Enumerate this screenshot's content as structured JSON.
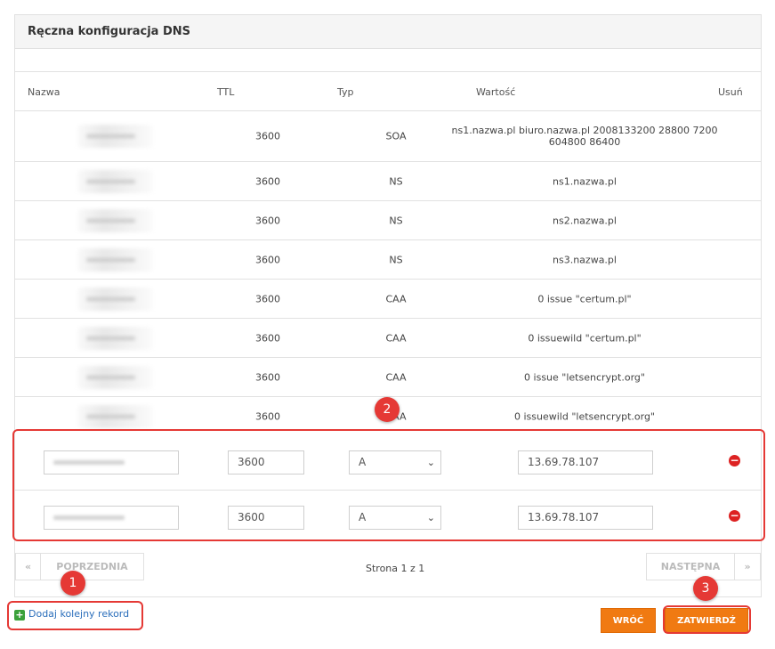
{
  "panel": {
    "title": "Ręczna konfiguracja DNS"
  },
  "table": {
    "headers": {
      "name": "Nazwa",
      "ttl": "TTL",
      "type": "Typ",
      "value": "Wartość",
      "delete": "Usuń"
    },
    "rows": [
      {
        "ttl": "3600",
        "type": "SOA",
        "value": "ns1.nazwa.pl biuro.nazwa.pl 2008133200 28800 7200 604800 86400"
      },
      {
        "ttl": "3600",
        "type": "NS",
        "value": "ns1.nazwa.pl"
      },
      {
        "ttl": "3600",
        "type": "NS",
        "value": "ns2.nazwa.pl"
      },
      {
        "ttl": "3600",
        "type": "NS",
        "value": "ns3.nazwa.pl"
      },
      {
        "ttl": "3600",
        "type": "CAA",
        "value": "0 issue \"certum.pl\""
      },
      {
        "ttl": "3600",
        "type": "CAA",
        "value": "0 issuewild \"certum.pl\""
      },
      {
        "ttl": "3600",
        "type": "CAA",
        "value": "0 issue \"letsencrypt.org\""
      },
      {
        "ttl": "3600",
        "type": "CAA",
        "value": "0 issuewild \"letsencrypt.org\""
      }
    ],
    "edit_rows": [
      {
        "ttl": "3600",
        "type": "A",
        "value": "13.69.78.107"
      },
      {
        "ttl": "3600",
        "type": "A",
        "value": "13.69.78.107"
      }
    ]
  },
  "pager": {
    "first": "«",
    "prev": "POPRZEDNIA",
    "info": "Strona 1 z 1",
    "next": "NASTĘPNA",
    "last": "»"
  },
  "actions": {
    "add_record": "Dodaj kolejny rekord",
    "back": "WRÓĆ",
    "confirm": "ZATWIERDŹ"
  },
  "annotations": {
    "badge1": "1",
    "badge2": "2",
    "badge3": "3"
  },
  "colors": {
    "accent": "#f07a12",
    "highlight": "#e53935",
    "link": "#2a6ebb",
    "delete": "#dd2222"
  },
  "icons": {
    "add": "plus-icon",
    "delete": "minus-circle-icon",
    "select": "chevron-down-icon"
  }
}
